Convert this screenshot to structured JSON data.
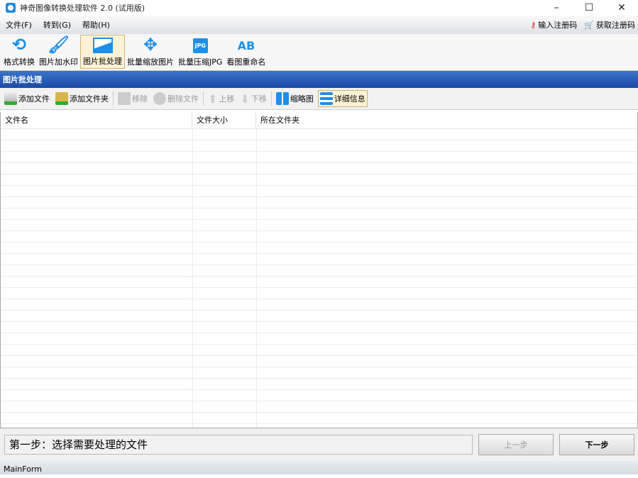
{
  "window": {
    "title": "神奇图像转换处理软件 2.0 (试用版)",
    "minimize": "–",
    "maximize": "☐",
    "close": "✕"
  },
  "menu": {
    "items": [
      "文件(F)",
      "转到(G)",
      "帮助(H)"
    ],
    "register": "输入注册码",
    "get_code": "获取注册码"
  },
  "toolbar": {
    "items": [
      "格式转换",
      "图片加水印",
      "图片批处理",
      "批量缩放图片",
      "批量压缩JPG",
      "看图重命名"
    ],
    "active": 2
  },
  "section_title": "图片批处理",
  "subtoolbar": {
    "add_file": "添加文件",
    "add_folder": "添加文件夹",
    "remove": "移除",
    "delete_file": "删除文件",
    "move_up": "上移",
    "move_down": "下移",
    "thumbnail": "缩略图",
    "details": "详细信息"
  },
  "table": {
    "headers": [
      "文件名",
      "文件大小",
      "所在文件夹"
    ]
  },
  "bottom": {
    "step_text": "第一步：选择需要处理的文件",
    "prev": "上一步",
    "next": "下一步"
  },
  "status": "MainForm"
}
